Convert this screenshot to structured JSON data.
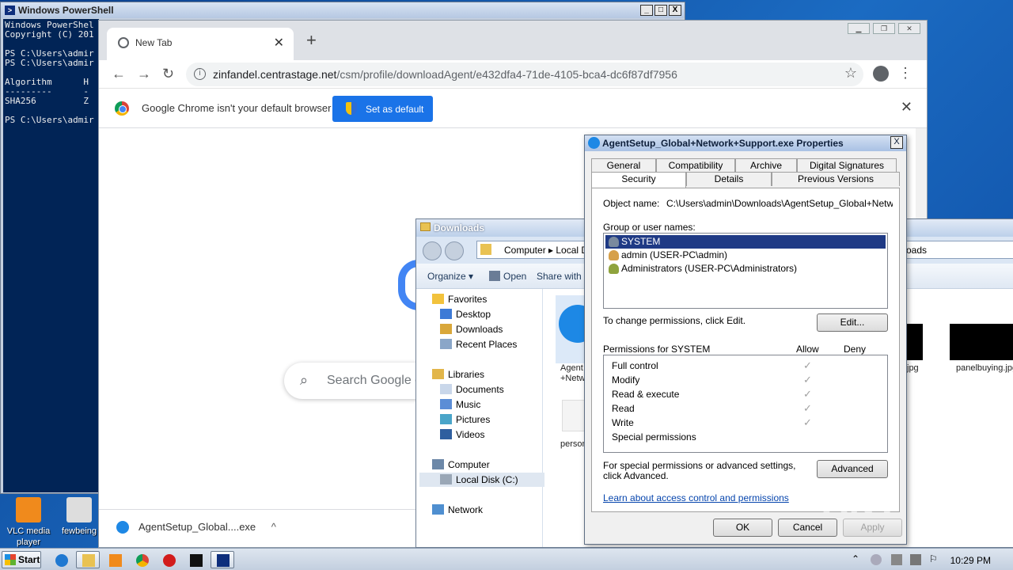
{
  "desktop": {
    "icons": [
      {
        "label": "VLC media player"
      },
      {
        "label": "fewbeing"
      }
    ]
  },
  "powershell": {
    "title": "Windows PowerShell",
    "console_text": "Windows PowerShel\nCopyright (C) 201\n\nPS C:\\Users\\admir\nPS C:\\Users\\admir\n\nAlgorithm      H\n---------      -\nSHA256         Z\n\nPS C:\\Users\\admir",
    "buttons": [
      "_",
      "□",
      "X"
    ]
  },
  "chrome": {
    "tab_title": "New Tab",
    "tab_close": "✕",
    "new_tab": "+",
    "url_host": "zinfandel.centrastage.net",
    "url_path": "/csm/profile/downloadAgent/e432dfa4-71de-4105-bca4-dc6f87df7956",
    "infobar_message": "Google Chrome isn't your default browser",
    "set_default_label": "Set as default",
    "search_placeholder": "Search Google o",
    "download_item": "AgentSetup_Global....exe"
  },
  "explorer": {
    "title": "Downloads",
    "breadcrumb": "Computer ▸ Local Di",
    "right_address": "oads",
    "commands": [
      "Organize ▾",
      "Open",
      "Share with"
    ],
    "tree": [
      {
        "label": "Favorites",
        "level": 0
      },
      {
        "label": "Desktop",
        "level": 1
      },
      {
        "label": "Downloads",
        "level": 1
      },
      {
        "label": "Recent Places",
        "level": 1
      },
      {
        "label": "Libraries",
        "level": 0
      },
      {
        "label": "Documents",
        "level": 1
      },
      {
        "label": "Music",
        "level": 1
      },
      {
        "label": "Pictures",
        "level": 1
      },
      {
        "label": "Videos",
        "level": 1
      },
      {
        "label": "Computer",
        "level": 0
      },
      {
        "label": "Local Disk (C:)",
        "level": 1,
        "selected": true
      },
      {
        "label": "Network",
        "level": 0
      }
    ],
    "files": [
      {
        "label": "Agent\n+Netw"
      },
      {
        "label": "person"
      },
      {
        "label": "jpg"
      },
      {
        "label": "panelbuying.jpg"
      }
    ]
  },
  "dialog": {
    "title": "AgentSetup_Global+Network+Support.exe Properties",
    "tabs_row1": [
      "General",
      "Compatibility",
      "Archive",
      "Digital Signatures"
    ],
    "tabs_row2": [
      "Security",
      "Details",
      "Previous Versions"
    ],
    "object_name_label": "Object name:",
    "object_name_value": "C:\\Users\\admin\\Downloads\\AgentSetup_Global+Network+",
    "group_label": "Group or user names:",
    "groups": [
      "SYSTEM",
      "admin (USER-PC\\admin)",
      "Administrators (USER-PC\\Administrators)"
    ],
    "change_perms_text": "To change permissions, click Edit.",
    "edit_button": "Edit...",
    "perms_for_label": "Permissions for SYSTEM",
    "allow_label": "Allow",
    "deny_label": "Deny",
    "permissions": [
      {
        "name": "Full control",
        "allow": true
      },
      {
        "name": "Modify",
        "allow": true
      },
      {
        "name": "Read & execute",
        "allow": true
      },
      {
        "name": "Read",
        "allow": true
      },
      {
        "name": "Write",
        "allow": true
      },
      {
        "name": "Special permissions",
        "allow": false
      }
    ],
    "special_text": "For special permissions or advanced settings, click Advanced.",
    "advanced_button": "Advanced",
    "learn_link": "Learn about access control and permissions",
    "ok_button": "OK",
    "cancel_button": "Cancel",
    "apply_button": "Apply"
  },
  "taskbar": {
    "start_label": "Start",
    "clock": "10:29 PM",
    "watermark": "ANY RUN"
  }
}
